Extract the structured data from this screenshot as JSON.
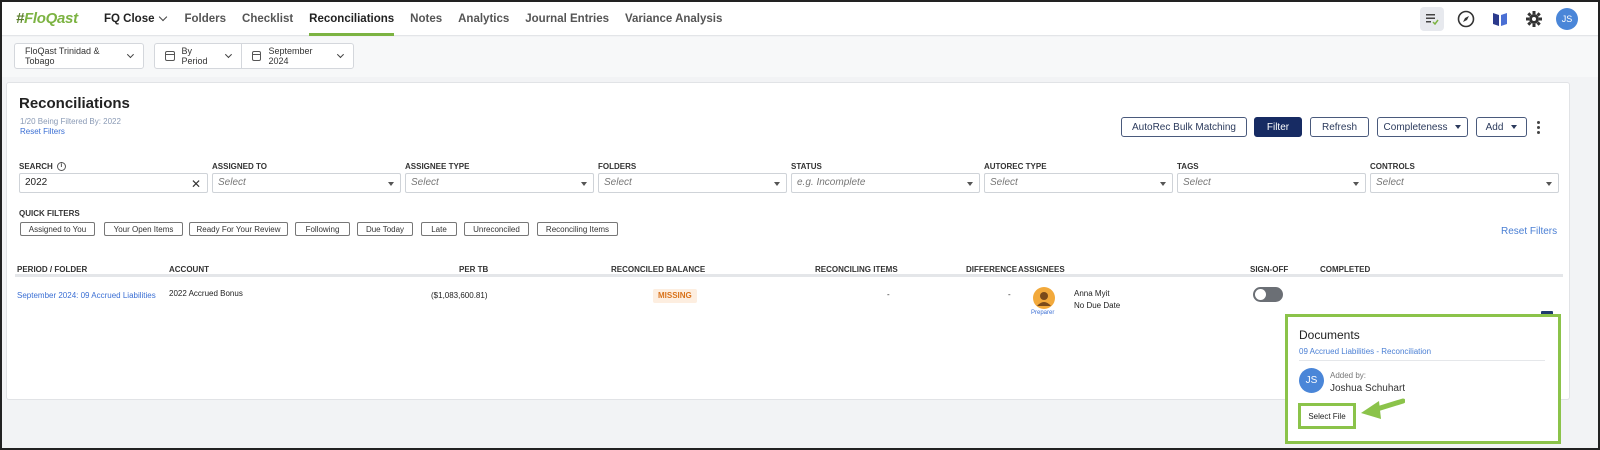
{
  "nav": {
    "logo": "FloQast",
    "fq_close": "FQ Close",
    "items": [
      "Folders",
      "Checklist",
      "Reconciliations",
      "Notes",
      "Analytics",
      "Journal Entries",
      "Variance Analysis"
    ],
    "active": "Reconciliations",
    "user_initials": "JS",
    "icons": [
      "task-list-icon",
      "compass-icon",
      "book-icon",
      "gear-icon"
    ]
  },
  "selectors": {
    "entity": "FloQast Trinidad & Tobago",
    "period_mode": "By Period",
    "period": "September 2024"
  },
  "page": {
    "title": "Reconciliations",
    "filter_summary": "1/20 Being Filtered By: 2022",
    "reset_filters": "Reset Filters"
  },
  "actions": {
    "autorec": "AutoRec Bulk Matching",
    "filter": "Filter",
    "refresh": "Refresh",
    "completeness": "Completeness",
    "add": "Add"
  },
  "filters": {
    "search_label": "SEARCH",
    "search_value": "2022",
    "fields": [
      {
        "label": "ASSIGNED TO",
        "placeholder": "Select"
      },
      {
        "label": "ASSIGNEE TYPE",
        "placeholder": "Select"
      },
      {
        "label": "FOLDERS",
        "placeholder": "Select"
      },
      {
        "label": "STATUS",
        "placeholder": "e.g. Incomplete"
      },
      {
        "label": "AUTOREC TYPE",
        "placeholder": "Select"
      },
      {
        "label": "TAGS",
        "placeholder": "Select"
      },
      {
        "label": "CONTROLS",
        "placeholder": "Select"
      }
    ]
  },
  "quick_filters": {
    "label": "QUICK FILTERS",
    "chips": [
      "Assigned to You",
      "Your Open Items",
      "Ready For Your Review",
      "Following",
      "Due Today",
      "Late",
      "Unreconciled",
      "Reconciling Items"
    ],
    "reset": "Reset Filters"
  },
  "table": {
    "headers": [
      "PERIOD / FOLDER",
      "ACCOUNT",
      "PER TB",
      "RECONCILED BALANCE",
      "RECONCILING ITEMS",
      "DIFFERENCE",
      "ASSIGNEES",
      "SIGN-OFF",
      "COMPLETED"
    ],
    "row": {
      "period_folder": "September 2024: 09 Accrued Liabilities",
      "account": "2022 Accrued Bonus",
      "per_tb": "($1,083,600.81)",
      "reconciled_balance": "MISSING",
      "reconciling_items": "-",
      "difference": "-",
      "assignee_name": "Anna Myit",
      "assignee_due": "No Due Date",
      "assignee_role": "Preparer"
    }
  },
  "documents": {
    "title": "Documents",
    "link": "09 Accrued Liabilities - Reconciliation",
    "added_by_label": "Added by:",
    "added_by_name": "Joshua Schuhart",
    "initials": "JS",
    "select_file": "Select File"
  },
  "colors": {
    "accent_green": "#8bc34a",
    "primary_navy": "#172b63",
    "link_blue": "#3b6fd4",
    "missing_orange": "#d9731c"
  }
}
